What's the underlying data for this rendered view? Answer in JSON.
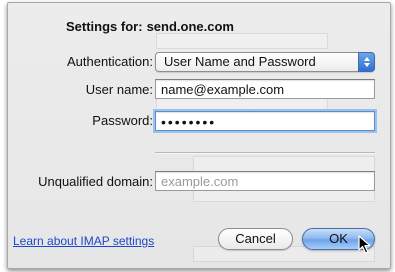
{
  "header": {
    "settings_for_label": "Settings for:",
    "server_name": "send.one.com"
  },
  "form": {
    "authentication": {
      "label": "Authentication:",
      "selected": "User Name and Password"
    },
    "user_name": {
      "label": "User name:",
      "value": "name@example.com"
    },
    "password": {
      "label": "Password:",
      "value": "••••••••"
    },
    "unqualified_domain": {
      "label": "Unqualified domain:",
      "placeholder": "example.com"
    }
  },
  "footer": {
    "learn_link": "Learn about IMAP settings",
    "cancel_label": "Cancel",
    "ok_label": "OK"
  },
  "colors": {
    "link": "#1c47c9",
    "focus_ring": "#9cc1ee",
    "default_button": "#6ea4ea"
  },
  "icons": {
    "popup_arrows": "up-down-arrows-icon",
    "cursor": "mouse-pointer-icon"
  }
}
